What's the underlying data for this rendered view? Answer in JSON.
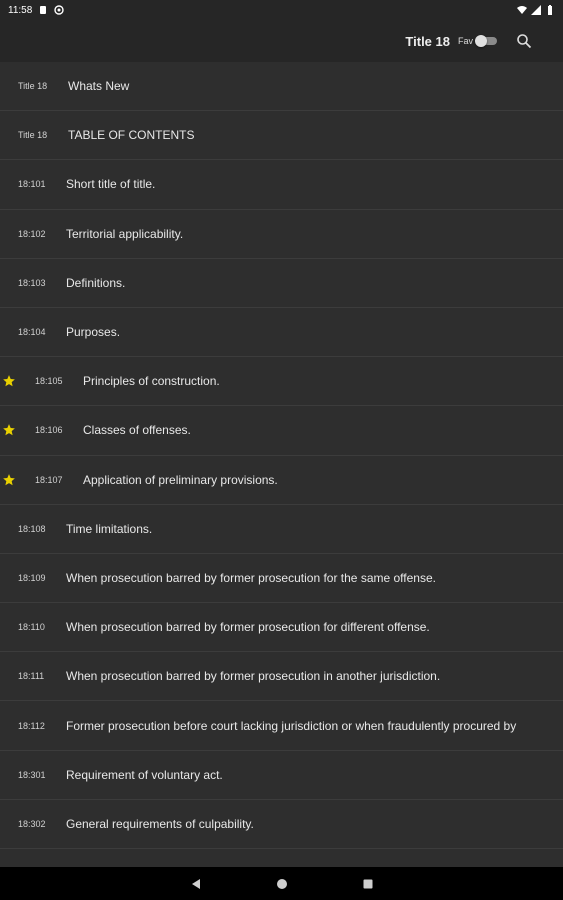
{
  "status_bar": {
    "time": "11:58"
  },
  "app_bar": {
    "title": "Title 18",
    "fav_label": "Fav"
  },
  "colors": {
    "star": "#e8d000",
    "background": "#2e2e2e",
    "bar": "#262626"
  },
  "rows": [
    {
      "code": "Title 18",
      "title": "Whats New",
      "fav": false,
      "kind": "head"
    },
    {
      "code": "Title 18",
      "title": "TABLE OF CONTENTS",
      "fav": false,
      "kind": "head"
    },
    {
      "code": "18:101",
      "title": "Short title of title.",
      "fav": false,
      "kind": "plain"
    },
    {
      "code": "18:102",
      "title": "Territorial applicability.",
      "fav": false,
      "kind": "plain"
    },
    {
      "code": "18:103",
      "title": "Definitions.",
      "fav": false,
      "kind": "plain"
    },
    {
      "code": "18:104",
      "title": "Purposes.",
      "fav": false,
      "kind": "plain"
    },
    {
      "code": "18:105",
      "title": "Principles of construction.",
      "fav": true,
      "kind": "fav"
    },
    {
      "code": "18:106",
      "title": "Classes of offenses.",
      "fav": true,
      "kind": "fav"
    },
    {
      "code": "18:107",
      "title": "Application of preliminary provisions.",
      "fav": true,
      "kind": "fav"
    },
    {
      "code": "18:108",
      "title": "Time limitations.",
      "fav": false,
      "kind": "plain"
    },
    {
      "code": "18:109",
      "title": "When prosecution barred by former prosecution for the same offense.",
      "fav": false,
      "kind": "plain"
    },
    {
      "code": "18:110",
      "title": "When prosecution barred by former prosecution for different offense.",
      "fav": false,
      "kind": "plain"
    },
    {
      "code": "18:111",
      "title": "When prosecution barred by former prosecution in another jurisdiction.",
      "fav": false,
      "kind": "plain"
    },
    {
      "code": "18:112",
      "title": "Former prosecution before court lacking jurisdiction or when fraudulently procured by",
      "fav": false,
      "kind": "plain"
    },
    {
      "code": "18:301",
      "title": "Requirement of voluntary act.",
      "fav": false,
      "kind": "plain"
    },
    {
      "code": "18:302",
      "title": "General requirements of culpability.",
      "fav": false,
      "kind": "plain"
    }
  ]
}
